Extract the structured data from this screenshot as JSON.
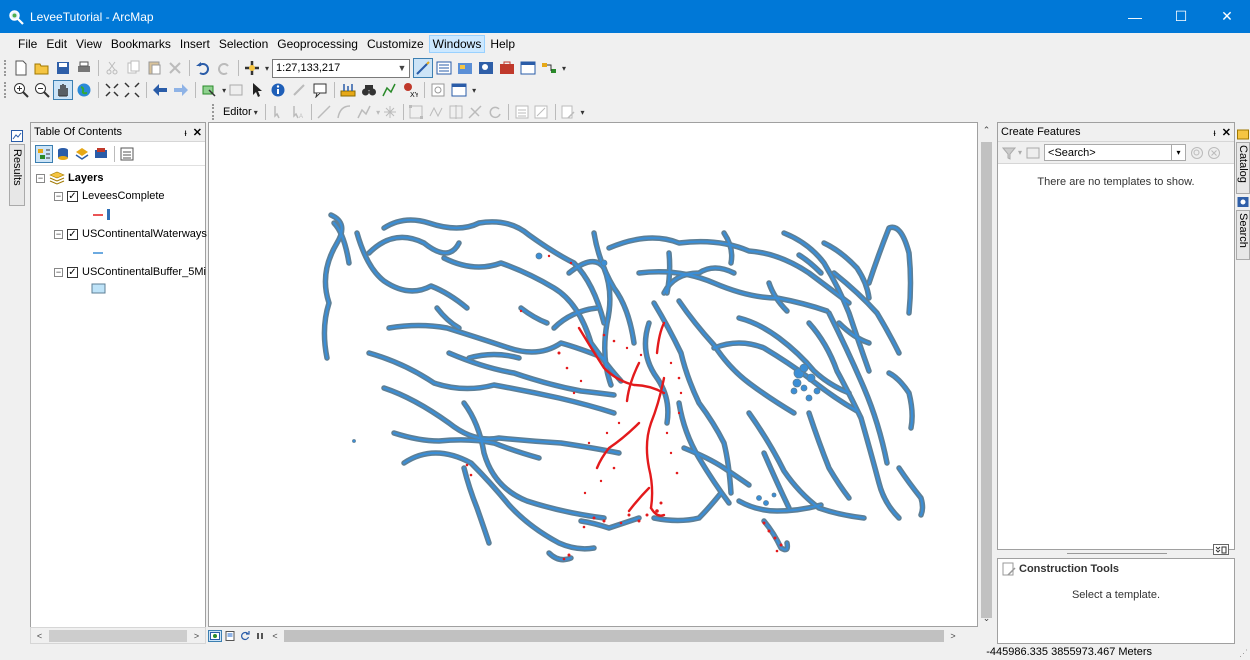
{
  "window": {
    "title": "LeveeTutorial - ArcMap",
    "minimize_glyph": "—",
    "maximize_glyph": "☐",
    "close_glyph": "✕"
  },
  "menu": {
    "items": [
      "File",
      "Edit",
      "View",
      "Bookmarks",
      "Insert",
      "Selection",
      "Geoprocessing",
      "Customize",
      "Windows",
      "Help"
    ],
    "active": "Windows"
  },
  "standard_toolbar": {
    "scale": "1:27,133,217"
  },
  "editor_toolbar": {
    "editor_label": "Editor"
  },
  "left_tabs": {
    "results": "Results"
  },
  "toc": {
    "title": "Table Of Contents",
    "pin_glyph": "ᵼ",
    "close_glyph": "✕",
    "root_label": "Layers",
    "layers": [
      {
        "name": "LeveesComplete",
        "checked": true,
        "legend": "line-red"
      },
      {
        "name": "USContinentalWaterways",
        "checked": true,
        "legend": "line-blue"
      },
      {
        "name": "USContinentalBuffer_5Mi",
        "checked": true,
        "legend": "fill-blue"
      }
    ]
  },
  "create_features": {
    "title": "Create Features",
    "search_placeholder": "<Search>",
    "empty_message": "There are no templates to show."
  },
  "construction_tools": {
    "title": "Construction Tools",
    "message": "Select a template."
  },
  "right_tabs": {
    "catalog": "Catalog",
    "search": "Search"
  },
  "status": {
    "coordinates": "-445986.335  3855973.467 Meters"
  },
  "colors": {
    "titlebar": "#0078d7",
    "waterway": "#3b8ed6",
    "buffer_outline": "#5d7f96",
    "levee": "#e31a1c"
  }
}
